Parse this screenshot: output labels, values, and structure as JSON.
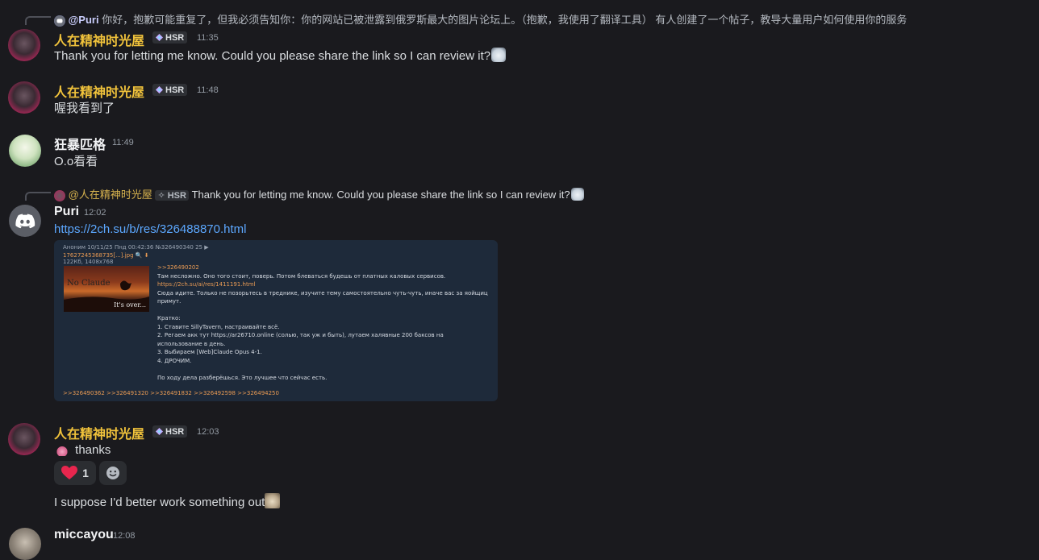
{
  "colors": {
    "background": "#1a1a1e",
    "gold_name": "#f0c23b",
    "link": "#5ca8ff",
    "tag_bg": "#2e3035"
  },
  "reply1": {
    "mention": "@Puri",
    "text": "你好，抱歉可能重复了，但我必须告知你：你的网站已被泄露到俄罗斯最大的图片论坛上。（抱歉，我使用了翻译工具） 有人创建了一个帖子，教导大量用户如何使用你的服务"
  },
  "messages": {
    "m1": {
      "author": "人在精神时光屋",
      "tag": "HSR",
      "time": "11:35",
      "text": "Thank you for letting me know. Could you please share the link so I can review it?"
    },
    "m2": {
      "author": "人在精神时光屋",
      "tag": "HSR",
      "time": "11:48",
      "text": "喔我看到了"
    },
    "m3": {
      "author": "狂暴匹格",
      "time": "11:49",
      "text": "O.o看看"
    },
    "m4": {
      "author": "Puri",
      "time": "12:02",
      "link": "https://2ch.su/b/res/326488870.html"
    },
    "m5": {
      "author": "人在精神时光屋",
      "tag": "HSR",
      "time": "12:03",
      "text": "thanks",
      "followup": "I suppose I'd better work something out"
    },
    "m6": {
      "author": "miccayou",
      "time": "12:08"
    }
  },
  "reply2": {
    "mention": "@人在精神时光屋",
    "tag": "HSR",
    "text": "Thank you for letting me know. Could you please share the link so I can review it?"
  },
  "reactions": {
    "heart_count": "1"
  },
  "embed": {
    "header": "Аноним 10/11/25 Пнд 00:42:36 №326490340 25 ▶",
    "file_name": "17627245368735[...].jpg 🔍 ⬇",
    "file_meta": "122Кб, 1408x768",
    "thumb_text": "No Claude",
    "thumb_caption": "It's over...",
    "post_lines": [
      ">>326490202",
      "Там несложно. Оно того стоит, поверь. Потом блеваться будешь от платных каловых сервисов.",
      "https://2ch.su/ai/res/1411191.html",
      "Сюда идите. Только не позорьтесь в треднике, изучите тему самостоятельно чуть-чуть, иначе вас за яойщиц",
      "примут.",
      "",
      "Кратко:",
      "1. Ставите SillyTavern, настраивайте всё.",
      "2. Регаем акк тут https://ar26710.online (солью, так уж и быть), лутаем халявные 200 баксов на",
      "использование в день.",
      "3. Выбираем [Web]Claude Opus 4-1.",
      "4. ДРОЧИМ.",
      "",
      "По ходу дела разберёшься. Это лучшее что сейчас есть."
    ],
    "footer": ">>326490362 >>326491320 >>326491832 >>326492598 >>326494250"
  },
  "icons": [
    "reply-avatar-icon",
    "discord-logo-icon",
    "cat-emoji-icon",
    "heart-icon",
    "add-reaction-icon",
    "cat-photo-emoji-icon",
    "hsr-diamond-icon"
  ]
}
